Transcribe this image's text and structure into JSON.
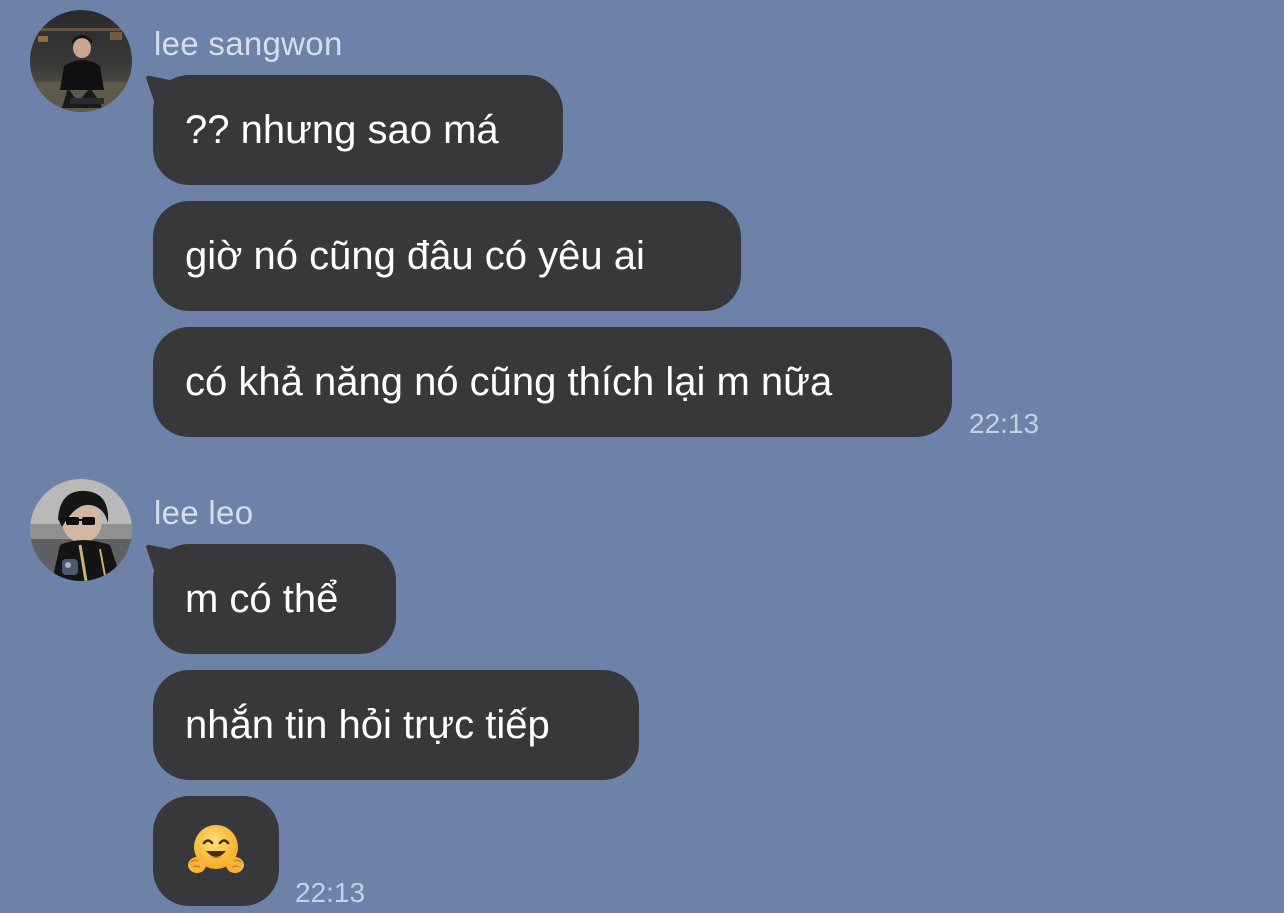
{
  "conversation": {
    "groups": [
      {
        "sender": "lee sangwon",
        "avatar_icon": "profile-photo-dark-outfit",
        "messages": [
          "?? nhưng sao má",
          "giờ nó cũng đâu có yêu ai",
          "có khả năng nó cũng thích lại m nữa"
        ],
        "time": "22:13"
      },
      {
        "sender": "lee leo",
        "avatar_icon": "profile-photo-sunglasses",
        "messages": [
          "m có thể",
          "nhắn tin hỏi trực tiếp"
        ],
        "emoji_message": "hugging-face-emoji",
        "time": "22:13"
      }
    ]
  },
  "colors": {
    "background": "#6d81a9",
    "bubble": "#38383a",
    "bubble_text": "#ffffff",
    "meta_text": "#d6deee"
  }
}
